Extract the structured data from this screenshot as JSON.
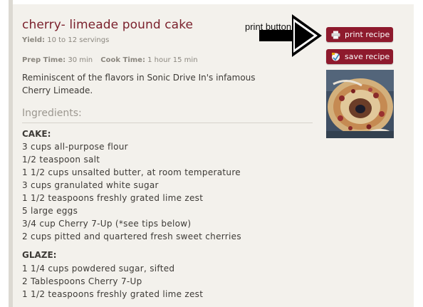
{
  "recipe": {
    "title": "cherry- limeade pound cake",
    "yield_label": "Yield:",
    "yield_value": "10 to 12 servings",
    "prep_label": "Prep Time:",
    "prep_value": "30 min",
    "cook_label": "Cook Time:",
    "cook_value": "1 hour 15 min",
    "description": "Reminiscent of the flavors in Sonic Drive In's infamous Cherry Limeade.",
    "ingredients_heading": "Ingredients:",
    "sections": [
      {
        "name": "CAKE:",
        "items": [
          "3 cups all-purpose flour",
          "1/2 teaspoon salt",
          "1 1/2 cups unsalted butter, at room temperature",
          "3 cups granulated white sugar",
          "1 1/2 teaspoons freshly grated lime zest",
          "5 large eggs",
          "3/4 cup Cherry 7-Up (*see tips below)",
          "2 cups pitted and quartered fresh sweet cherries"
        ]
      },
      {
        "name": "GLAZE:",
        "items": [
          "1 1/4 cups powdered sugar, sifted",
          "2 Tablespoons Cherry 7-Up",
          "1 1/2 teaspoons freshly grated lime zest"
        ]
      }
    ]
  },
  "actions": {
    "print_label": "print recipe",
    "print_icon": "printer-icon",
    "save_label": "save recipe",
    "save_icon": "save-recipe-icon"
  },
  "annotation": {
    "label": "print button",
    "arrow_icon": "right-arrow-icon"
  },
  "colors": {
    "title": "#7a1f2b",
    "button_bg": "#8e1a2d",
    "card_bg": "#f3f1ec"
  }
}
